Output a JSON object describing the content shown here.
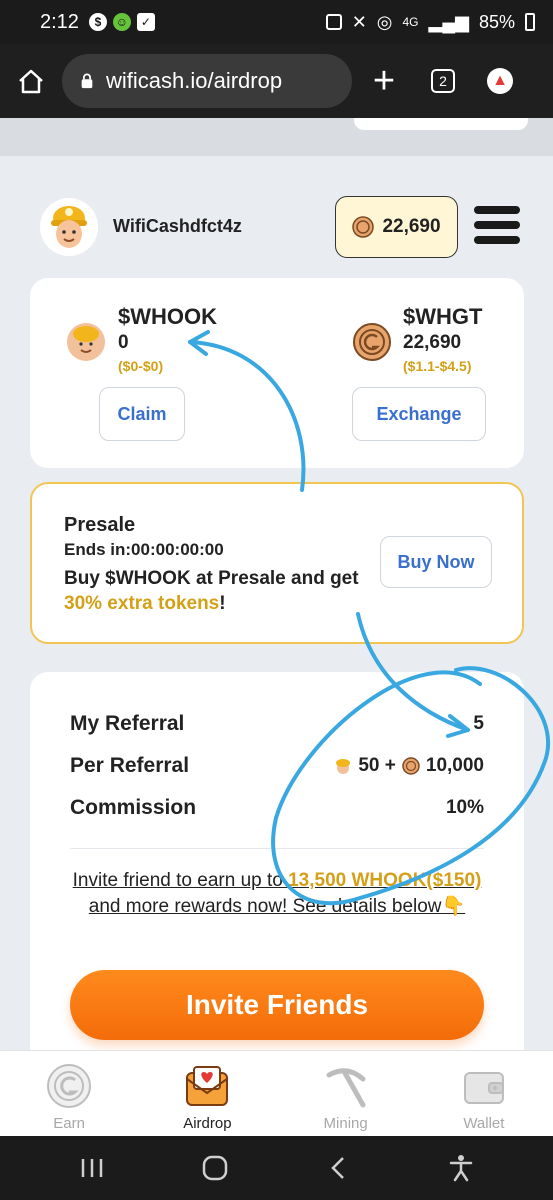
{
  "status_bar": {
    "time": "2:12",
    "network": "4G",
    "battery": "85%"
  },
  "browser": {
    "url": "wificash.io/airdrop",
    "tab_count": "2"
  },
  "profile": {
    "username": "WifiCashdfct4z",
    "balance": "22,690"
  },
  "tokens": [
    {
      "name": "$WHOOK",
      "value": "0",
      "range": "($0-$0)",
      "button": "Claim"
    },
    {
      "name": "$WHGT",
      "value": "22,690",
      "range": "($1.1-$4.5)",
      "button": "Exchange"
    }
  ],
  "presale": {
    "title": "Presale",
    "ends": "Ends in:00:00:00:00",
    "desc_prefix": "Buy $WHOOK at Presale and get ",
    "desc_highlight": "30% extra tokens",
    "desc_suffix": "!",
    "button": "Buy Now"
  },
  "referral": {
    "rows": [
      {
        "label": "My Referral",
        "value": "5"
      },
      {
        "label": "Per Referral",
        "value_a": "50 +",
        "value_b": "10,000"
      },
      {
        "label": "Commission",
        "value": "10%"
      }
    ],
    "invite_prefix": "Invite friend to earn up to ",
    "invite_highlight": "13,500 WHOOK($150)",
    "invite_suffix": " and more rewards now! See details below",
    "invite_emoji": "👇",
    "invite_button": "Invite Friends"
  },
  "bottom_nav": [
    {
      "label": "Earn",
      "active": false
    },
    {
      "label": "Airdrop",
      "active": true
    },
    {
      "label": "Mining",
      "active": false
    },
    {
      "label": "Wallet",
      "active": false
    }
  ],
  "colors": {
    "accent_orange": "#f36c0a",
    "gold": "#d4a017",
    "link_blue": "#3a6fd0",
    "scribble_blue": "#3aa8e0"
  }
}
